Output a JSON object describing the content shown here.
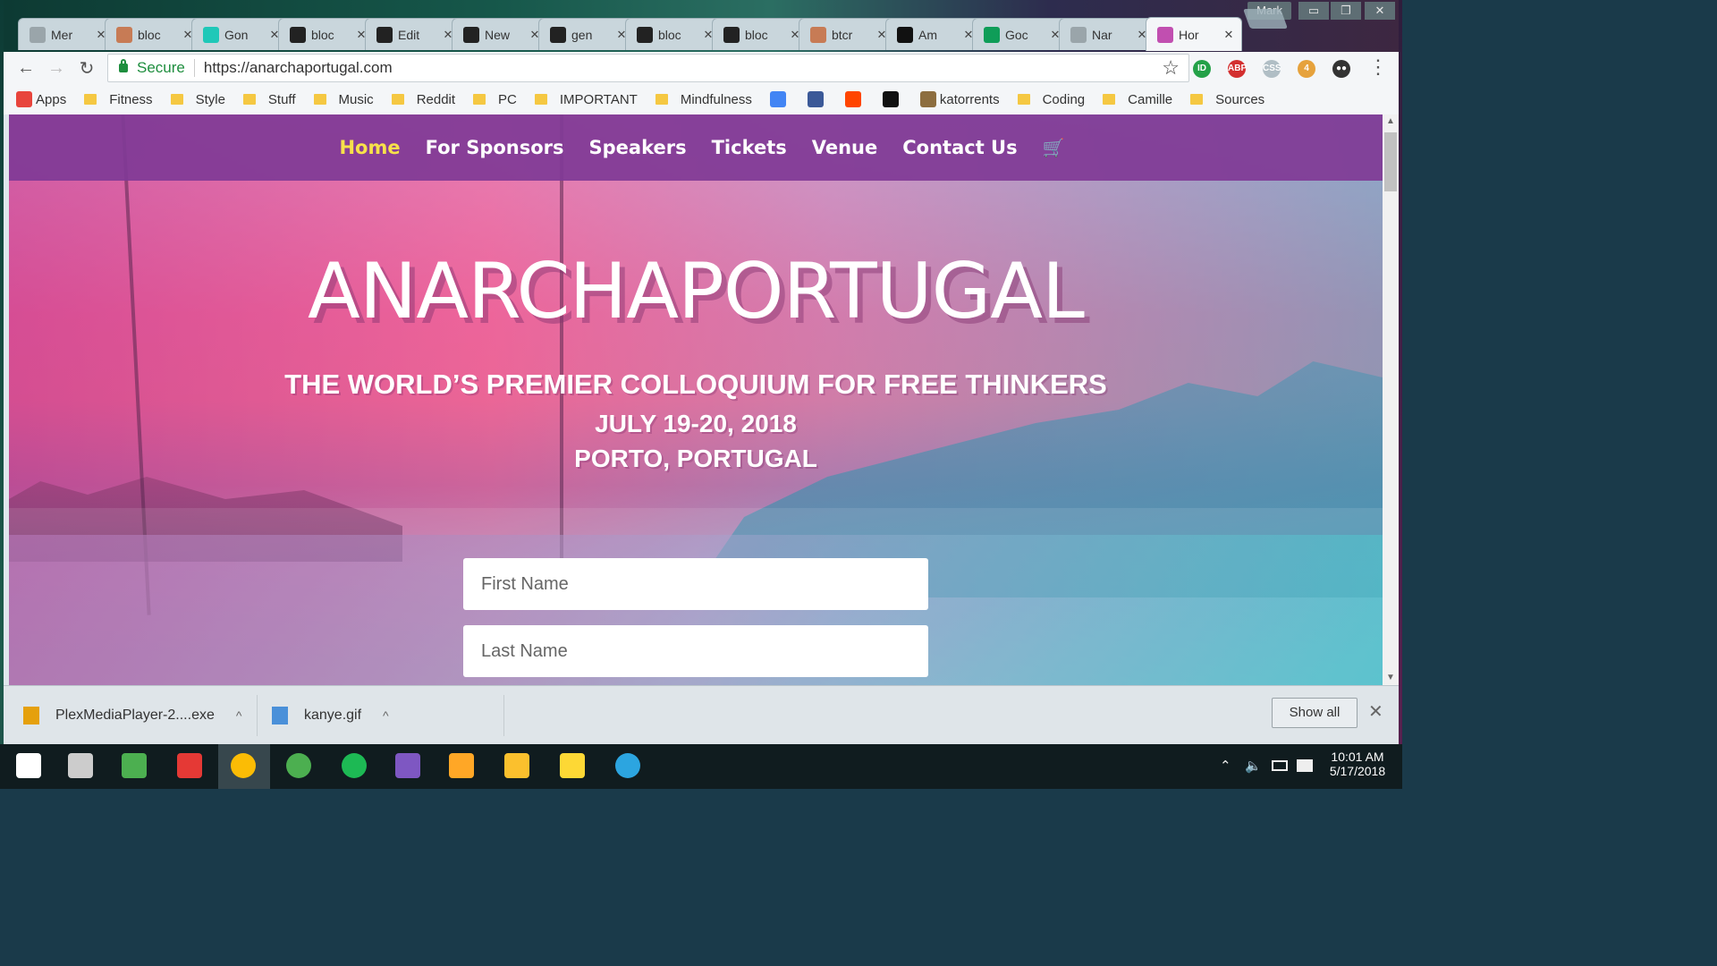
{
  "window": {
    "profile_name": "Mark",
    "controls": {
      "minimize": "▭",
      "maximize": "❐",
      "close": "✕"
    }
  },
  "tabs": [
    {
      "title": "Mer",
      "icon": "doc-icon",
      "color": "#9aa5aa",
      "active": false
    },
    {
      "title": "bloc",
      "icon": "comic-icon",
      "color": "#c77b55",
      "active": false
    },
    {
      "title": "Gon",
      "icon": "teal-circle-icon",
      "color": "#1fc8b8",
      "active": false
    },
    {
      "title": "bloc",
      "icon": "github-icon",
      "color": "#222222",
      "active": false
    },
    {
      "title": "Edit",
      "icon": "github-icon",
      "color": "#222222",
      "active": false
    },
    {
      "title": "New",
      "icon": "github-icon",
      "color": "#222222",
      "active": false
    },
    {
      "title": "gen",
      "icon": "github-icon",
      "color": "#222222",
      "active": false
    },
    {
      "title": "bloc",
      "icon": "github-icon",
      "color": "#222222",
      "active": false
    },
    {
      "title": "bloc",
      "icon": "github-icon",
      "color": "#222222",
      "active": false
    },
    {
      "title": "btcr",
      "icon": "comic-icon",
      "color": "#c77b55",
      "active": false
    },
    {
      "title": "Am",
      "icon": "amazon-icon",
      "color": "#111111",
      "active": false
    },
    {
      "title": "Goc",
      "icon": "hangouts-icon",
      "color": "#0f9d58",
      "active": false
    },
    {
      "title": "Nar",
      "icon": "doc-icon",
      "color": "#9aa5aa",
      "active": false
    },
    {
      "title": "Hor",
      "icon": "site-favicon-icon",
      "color": "#c14fb0",
      "active": true
    }
  ],
  "tab_close_glyph": "✕",
  "toolbar": {
    "back": "←",
    "forward": "→",
    "reload": "↻",
    "secure_label": "Secure",
    "url": "https://anarchaportugal.com",
    "star": "☆",
    "menu": "⋮"
  },
  "extensions": [
    {
      "name": "honey-icon",
      "label": "ID",
      "color": "#24a148"
    },
    {
      "name": "adblock-plus-icon",
      "label": "ABP",
      "color": "#d32f2f"
    },
    {
      "name": "css-viewer-icon",
      "label": "CSS",
      "color": "#b0bec5"
    },
    {
      "name": "extension-badge-icon",
      "label": "4",
      "color": "#e6a23c"
    },
    {
      "name": "incognito-icon",
      "label": "●●",
      "color": "#333333"
    }
  ],
  "bookmarks": [
    {
      "label": "Apps",
      "type": "apps"
    },
    {
      "label": "Fitness",
      "type": "folder"
    },
    {
      "label": "Style",
      "type": "folder"
    },
    {
      "label": "Stuff",
      "type": "folder"
    },
    {
      "label": "Music",
      "type": "folder"
    },
    {
      "label": "Reddit",
      "type": "folder"
    },
    {
      "label": "PC",
      "type": "folder"
    },
    {
      "label": "IMPORTANT",
      "type": "folder"
    },
    {
      "label": "Mindfulness",
      "type": "folder"
    },
    {
      "label": "",
      "type": "inbox"
    },
    {
      "label": "",
      "type": "facebook"
    },
    {
      "label": "",
      "type": "reddit"
    },
    {
      "label": "",
      "type": "amazon"
    },
    {
      "label": "katorrents",
      "type": "torrent"
    },
    {
      "label": "Coding",
      "type": "folder"
    },
    {
      "label": "Camille",
      "type": "folder"
    },
    {
      "label": "Sources",
      "type": "folder"
    }
  ],
  "site": {
    "nav": [
      {
        "label": "Home",
        "active": true
      },
      {
        "label": "For Sponsors",
        "active": false
      },
      {
        "label": "Speakers",
        "active": false
      },
      {
        "label": "Tickets",
        "active": false
      },
      {
        "label": "Venue",
        "active": false
      },
      {
        "label": "Contact Us",
        "active": false
      }
    ],
    "cart_glyph": "🛒",
    "title": "ANARCHAPORTUGAL",
    "tagline": "THE WORLD’S PREMIER COLLOQUIUM FOR FREE THINKERS",
    "date": "JULY 19-20, 2018",
    "location": "PORTO, PORTUGAL",
    "form": {
      "first_name_placeholder": "First Name",
      "last_name_placeholder": "Last Name"
    }
  },
  "downloads": [
    {
      "file": "PlexMediaPlayer-2....exe",
      "icon": "plex-icon",
      "color": "#e5a00d"
    },
    {
      "file": "kanye.gif",
      "icon": "image-file-icon",
      "color": "#4a90d9"
    }
  ],
  "download_shelf": {
    "show_all": "Show all",
    "close": "✕",
    "caret": "^"
  },
  "taskbar": {
    "time": "10:01 AM",
    "date": "5/17/2018",
    "apps": [
      {
        "name": "start-icon",
        "color": "#ffffff"
      },
      {
        "name": "task-view-icon",
        "color": "#cccccc"
      },
      {
        "name": "clover-icon",
        "color": "#4caf50"
      },
      {
        "name": "app-grid-icon",
        "color": "#e53935"
      },
      {
        "name": "chrome-icon",
        "color": "#fbbc05"
      },
      {
        "name": "globe-icon",
        "color": "#4caf50"
      },
      {
        "name": "spotify-icon",
        "color": "#1db954"
      },
      {
        "name": "bird-icon",
        "color": "#7e57c2"
      },
      {
        "name": "brush-icon",
        "color": "#ffa726"
      },
      {
        "name": "keys-icon",
        "color": "#fbc02d"
      },
      {
        "name": "bulb-icon",
        "color": "#fdd835"
      },
      {
        "name": "telegram-icon",
        "color": "#2ca5e0"
      }
    ]
  }
}
